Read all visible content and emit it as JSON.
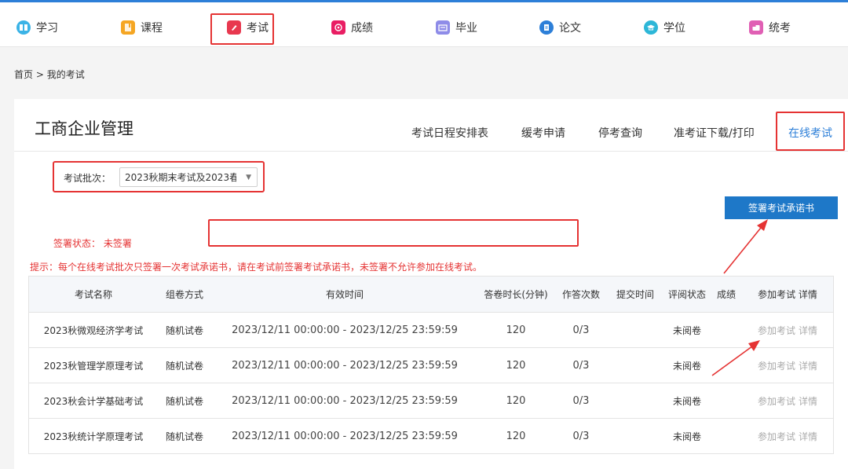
{
  "nav": {
    "items": [
      {
        "label": "学习",
        "icon": "study-icon",
        "color": "#3bb3e6"
      },
      {
        "label": "课程",
        "icon": "course-icon",
        "color": "#f5a623"
      },
      {
        "label": "考试",
        "icon": "exam-icon",
        "color": "#e8384f"
      },
      {
        "label": "成绩",
        "icon": "score-icon",
        "color": "#e91e63"
      },
      {
        "label": "毕业",
        "icon": "graduation-icon",
        "color": "#8e8ce8"
      },
      {
        "label": "论文",
        "icon": "thesis-icon",
        "color": "#2d7fd8"
      },
      {
        "label": "学位",
        "icon": "degree-cap-icon",
        "color": "#2db7d8"
      },
      {
        "label": "统考",
        "icon": "unified-exam-icon",
        "color": "#e05fb4"
      }
    ],
    "active": "考试"
  },
  "breadcrumb": {
    "home": "首页",
    "separator": ">",
    "current": "我的考试"
  },
  "course": {
    "title": "工商企业管理"
  },
  "tabs": [
    {
      "label": "考试日程安排表"
    },
    {
      "label": "缓考申请"
    },
    {
      "label": "停考查询"
    },
    {
      "label": "准考证下载/打印"
    },
    {
      "label": "在线考试"
    }
  ],
  "batch": {
    "label": "考试批次：",
    "selected": "2023秋期末考试及2023春"
  },
  "sign_button": {
    "label": "签署考试承诺书"
  },
  "sign_status": {
    "text": "签署状态： 未签署"
  },
  "notice": {
    "text": "提示：每个在线考试批次只签署一次考试承诺书，请在考试前签署考试承诺书，未签署不允许参加在线考试。"
  },
  "table": {
    "headers": {
      "name": "考试名称",
      "mode": "组卷方式",
      "time": "有效时间",
      "duration": "答卷时长(分钟)",
      "attempts": "作答次数",
      "submit": "提交时间",
      "review": "评阅状态",
      "score": "成绩",
      "action": "参加考试 详情"
    },
    "rows": [
      {
        "name": "2023秋微观经济学考试",
        "mode": "随机试卷",
        "time": "2023/12/11 00:00:00 - 2023/12/25 23:59:59",
        "duration": "120",
        "attempts": "0/3",
        "submit": "",
        "review": "未阅卷",
        "score": "",
        "join": "参加考试",
        "detail": "详情"
      },
      {
        "name": "2023秋管理学原理考试",
        "mode": "随机试卷",
        "time": "2023/12/11 00:00:00 - 2023/12/25 23:59:59",
        "duration": "120",
        "attempts": "0/3",
        "submit": "",
        "review": "未阅卷",
        "score": "",
        "join": "参加考试",
        "detail": "详情"
      },
      {
        "name": "2023秋会计学基础考试",
        "mode": "随机试卷",
        "time": "2023/12/11 00:00:00 - 2023/12/25 23:59:59",
        "duration": "120",
        "attempts": "0/3",
        "submit": "",
        "review": "未阅卷",
        "score": "",
        "join": "参加考试",
        "detail": "详情"
      },
      {
        "name": "2023秋统计学原理考试",
        "mode": "随机试卷",
        "time": "2023/12/11 00:00:00 - 2023/12/25 23:59:59",
        "duration": "120",
        "attempts": "0/3",
        "submit": "",
        "review": "未阅卷",
        "score": "",
        "join": "参加考试",
        "detail": "详情"
      }
    ]
  },
  "colors": {
    "accent": "#2d7fd8",
    "annotation": "#e53333",
    "button": "#1e78c8"
  }
}
